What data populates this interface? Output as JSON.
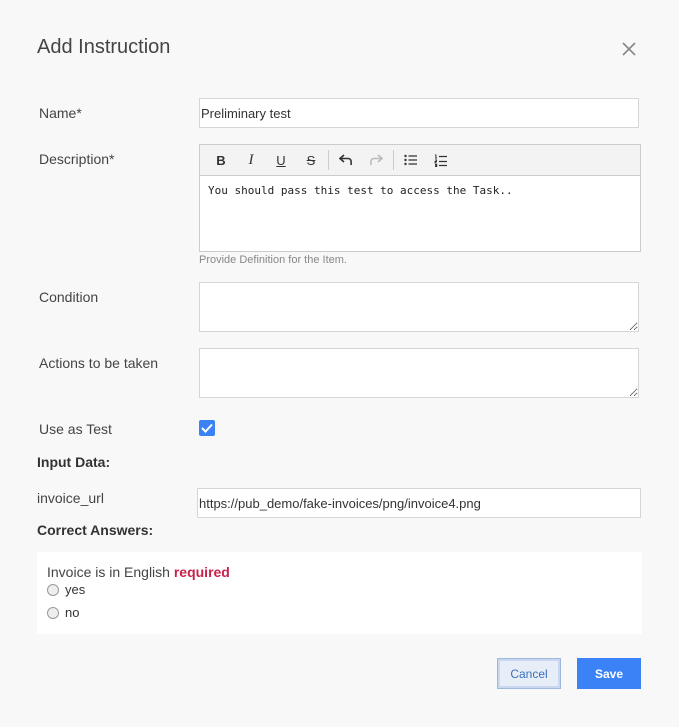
{
  "dialog": {
    "title": "Add Instruction"
  },
  "form": {
    "name_label": "Name*",
    "name_value": "Preliminary test",
    "description_label": "Description*",
    "description_value": "You should pass this test to access the Task..",
    "description_help": "Provide Definition for the Item.",
    "condition_label": "Condition",
    "condition_value": "",
    "actions_label": "Actions to be taken",
    "actions_value": "",
    "use_as_test_label": "Use as Test",
    "use_as_test_checked": true
  },
  "toolbar": {
    "bold": "B",
    "italic": "I",
    "underline": "U",
    "strike": "S"
  },
  "input_data": {
    "heading": "Input Data:",
    "field_label": "invoice_url",
    "field_value": "https://pub_demo/fake-invoices/png/invoice4.png"
  },
  "correct_answers": {
    "heading": "Correct Answers:",
    "question": "Invoice is in English",
    "required_label": "required",
    "options": [
      "yes",
      "no"
    ]
  },
  "buttons": {
    "cancel": "Cancel",
    "save": "Save"
  },
  "colors": {
    "accent": "#3b82f6",
    "required": "#c8234a"
  }
}
